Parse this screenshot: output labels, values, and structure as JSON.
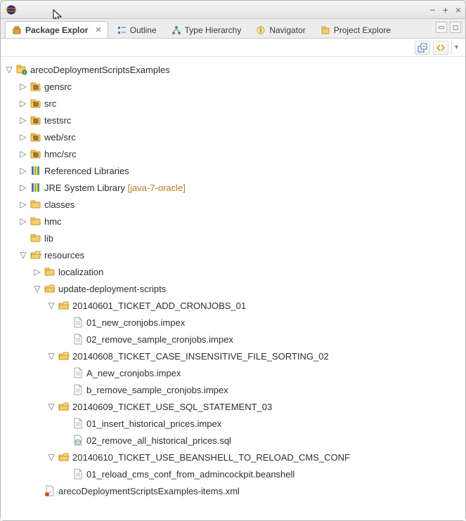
{
  "window": {
    "min_tooltip": "−",
    "max_tooltip": "+",
    "close_tooltip": "×"
  },
  "tabs": [
    {
      "id": "package-explorer",
      "label": "Package Explor",
      "icon": "package-explorer-icon",
      "active": true,
      "closable": true
    },
    {
      "id": "outline",
      "label": "Outline",
      "icon": "outline-icon",
      "active": false,
      "closable": false
    },
    {
      "id": "type-hierarchy",
      "label": "Type Hierarchy",
      "icon": "type-hierarchy-icon",
      "active": false,
      "closable": false
    },
    {
      "id": "navigator",
      "label": "Navigator",
      "icon": "navigator-icon",
      "active": false,
      "closable": false
    },
    {
      "id": "project-explorer",
      "label": "Project Explore",
      "icon": "project-explorer-icon",
      "active": false,
      "closable": false
    }
  ],
  "toolbar": {
    "collapse_all": "collapse-all",
    "link_editor": "link-with-editor",
    "view_menu": "view-menu"
  },
  "tree": [
    {
      "label": "arecoDeploymentScriptsExamples",
      "icon": "project-icon",
      "expanded": true,
      "children": [
        {
          "label": "gensrc",
          "icon": "package-folder-icon",
          "expanded": false,
          "children": []
        },
        {
          "label": "src",
          "icon": "package-folder-icon",
          "expanded": false,
          "children": []
        },
        {
          "label": "testsrc",
          "icon": "package-folder-icon",
          "expanded": false,
          "children": []
        },
        {
          "label": "web/src",
          "icon": "package-folder-icon",
          "expanded": false,
          "children": []
        },
        {
          "label": "hmc/src",
          "icon": "package-folder-icon",
          "expanded": false,
          "children": []
        },
        {
          "label": "Referenced Libraries",
          "icon": "library-icon",
          "expanded": false,
          "children": []
        },
        {
          "label": "JRE System Library",
          "suffix": " [java-7-oracle]",
          "icon": "library-icon",
          "expanded": false,
          "children": []
        },
        {
          "label": "classes",
          "icon": "folder-icon",
          "expanded": false,
          "children": []
        },
        {
          "label": "hmc",
          "icon": "folder-icon",
          "expanded": false,
          "children": []
        },
        {
          "label": "lib",
          "icon": "folder-icon",
          "leaf": true
        },
        {
          "label": "resources",
          "icon": "folder-open-icon",
          "expanded": true,
          "children": [
            {
              "label": "localization",
              "icon": "folder-icon",
              "expanded": false,
              "children": []
            },
            {
              "label": "update-deployment-scripts",
              "icon": "folder-open-icon",
              "expanded": true,
              "children": [
                {
                  "label": "20140601_TICKET_ADD_CRONJOBS_01",
                  "icon": "folder-open-icon",
                  "expanded": true,
                  "children": [
                    {
                      "label": "01_new_cronjobs.impex",
                      "icon": "file-icon",
                      "leaf": true
                    },
                    {
                      "label": "02_remove_sample_cronjobs.impex",
                      "icon": "file-icon",
                      "leaf": true
                    }
                  ]
                },
                {
                  "label": "20140608_TICKET_CASE_INSENSITIVE_FILE_SORTING_02",
                  "icon": "folder-open-icon",
                  "expanded": true,
                  "children": [
                    {
                      "label": "A_new_cronjobs.impex",
                      "icon": "file-icon",
                      "leaf": true
                    },
                    {
                      "label": "b_remove_sample_cronjobs.impex",
                      "icon": "file-icon",
                      "leaf": true
                    }
                  ]
                },
                {
                  "label": "20140609_TICKET_USE_SQL_STATEMENT_03",
                  "icon": "folder-open-icon",
                  "expanded": true,
                  "children": [
                    {
                      "label": "01_insert_historical_prices.impex",
                      "icon": "file-icon",
                      "leaf": true
                    },
                    {
                      "label": "02_remove_all_historical_prices.sql",
                      "icon": "file-sql-icon",
                      "leaf": true
                    }
                  ]
                },
                {
                  "label": "20140610_TICKET_USE_BEANSHELL_TO_RELOAD_CMS_CONF",
                  "icon": "folder-open-icon",
                  "expanded": true,
                  "children": [
                    {
                      "label": "01_reload_cms_conf_from_admincockpit.beanshell",
                      "icon": "file-icon",
                      "leaf": true
                    }
                  ]
                }
              ]
            },
            {
              "label": "arecoDeploymentScriptsExamples-items.xml",
              "icon": "file-xml-icon",
              "leaf": true
            }
          ]
        }
      ]
    }
  ]
}
